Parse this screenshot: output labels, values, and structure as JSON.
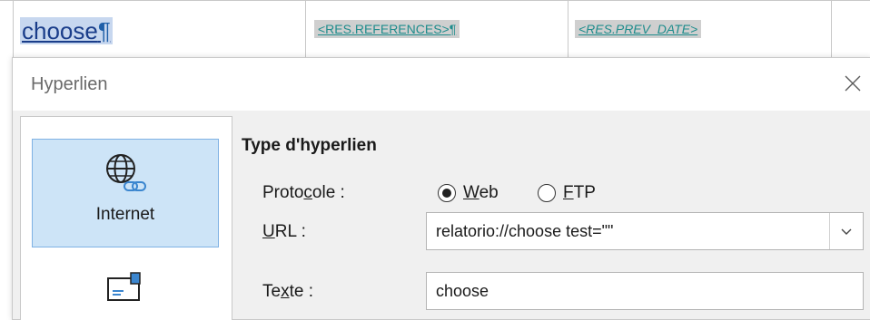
{
  "document": {
    "link_text": "choose",
    "pilcrow": "¶",
    "field_references": "<RES.REFERENCES>",
    "field_references_mark": "¶",
    "field_prev_date": "<RES.PREV_DATE>"
  },
  "dialog": {
    "title": "Hyperlien",
    "categories": [
      {
        "label": "Internet",
        "icon": "globe-link-icon",
        "active": true
      },
      {
        "label": "",
        "icon": "mail-icon",
        "active": false
      }
    ],
    "section_title": "Type d'hyperlien",
    "protocol": {
      "label_pre": "Proto",
      "label_mnemonic": "c",
      "label_post": "ole :",
      "options": [
        {
          "mnemonic": "W",
          "rest": "eb",
          "checked": true
        },
        {
          "mnemonic": "F",
          "rest": "TP",
          "checked": false
        }
      ]
    },
    "url": {
      "label_mnemonic": "U",
      "label_post": "RL :",
      "value": "relatorio://choose test=\"\""
    },
    "text": {
      "label_pre": "Te",
      "label_mnemonic": "x",
      "label_post": "te :",
      "value": "choose"
    }
  },
  "colors": {
    "active_category_bg": "#cde4f7",
    "active_category_border": "#7fb1e3",
    "dialog_body_bg": "#f0f0f0",
    "field_text": "#1e8c8c"
  }
}
